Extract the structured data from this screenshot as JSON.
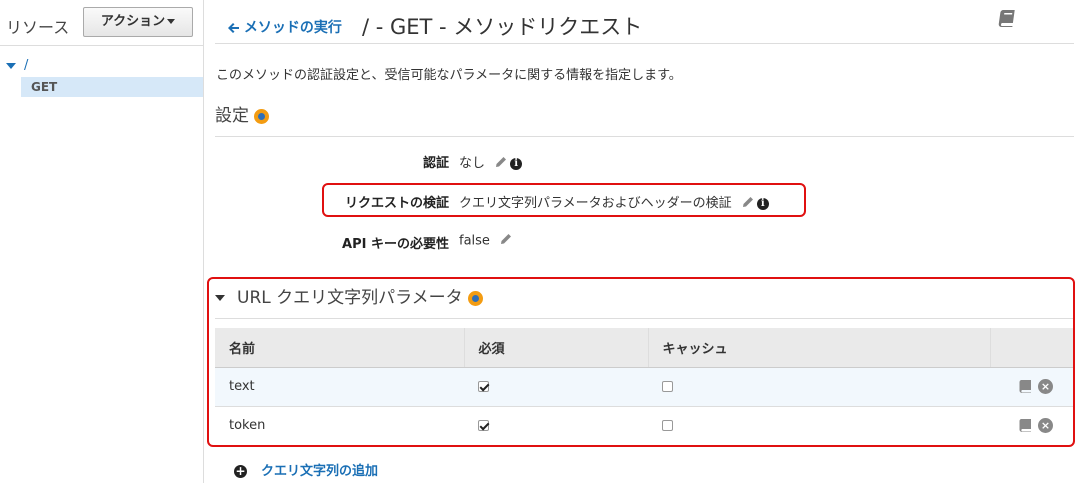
{
  "sidebar": {
    "title": "リソース",
    "action_button": "アクション",
    "tree_root": "/",
    "tree_method": "GET"
  },
  "header": {
    "back_link": "メソッドの実行",
    "title": "/ - GET - メソッドリクエスト"
  },
  "description": "このメソッドの認証設定と、受信可能なパラメータに関する情報を指定します。",
  "settings": {
    "title": "設定",
    "auth_label": "認証",
    "auth_value": "なし",
    "validation_label": "リクエストの検証",
    "validation_value": "クエリ文字列パラメータおよびヘッダーの検証",
    "apikey_label": "API キーの必要性",
    "apikey_value": "false"
  },
  "query_params": {
    "title": "URL クエリ文字列パラメータ",
    "columns": [
      "名前",
      "必須",
      "キャッシュ",
      ""
    ],
    "rows": [
      {
        "name": "text",
        "required": true,
        "cache": false
      },
      {
        "name": "token",
        "required": true,
        "cache": false
      }
    ],
    "add_label": "クエリ文字列の追加"
  },
  "colors": {
    "link": "#1a6fb5",
    "highlight": "#e01010",
    "accent": "#f39c12"
  }
}
